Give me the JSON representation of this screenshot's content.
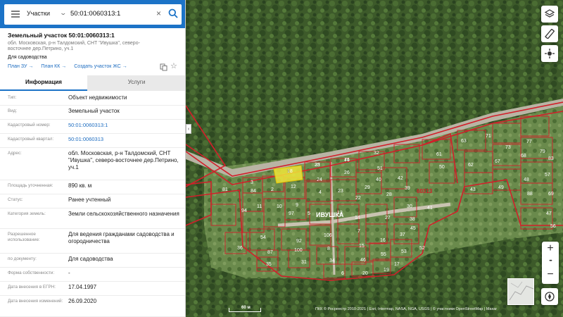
{
  "search": {
    "type_label": "Участки",
    "query": "50:01:0060313:1"
  },
  "object": {
    "title": "Земельный участок 50:01:0060313:1",
    "address_short": "обл. Московская, р-н Талдомский, СНТ \"Ивушка\", северо-восточнее дер.Петрино, уч.1",
    "purpose": "Для садоводства",
    "links": [
      "План ЗУ →",
      "План КК →",
      "Создать участок ЖС →"
    ]
  },
  "tabs": [
    "Информация",
    "Услуги"
  ],
  "info_rows": [
    {
      "label": "Тип:",
      "value": "Объект недвижимости",
      "link": false
    },
    {
      "label": "Вид:",
      "value": "Земельный участок",
      "link": false
    },
    {
      "label": "Кадастровый номер:",
      "value": "50:01:0060313:1",
      "link": true
    },
    {
      "label": "Кадастровый квартал:",
      "value": "50:01:0060313",
      "link": true
    },
    {
      "label": "Адрес:",
      "value": "обл. Московская, р-н Талдомский, СНТ \"Ивушка\", северо-восточнее дер.Петрино, уч.1",
      "link": false
    },
    {
      "label": "Площадь уточненная:",
      "value": "890 кв. м",
      "link": false
    },
    {
      "label": "Статус:",
      "value": "Ранее учтенный",
      "link": false
    },
    {
      "label": "Категория земель:",
      "value": "Земли сельскохозяйственного назначения",
      "link": false
    },
    {
      "label": "Разрешенное использование:",
      "value": "Для ведения гражданами садоводства и огородничества",
      "link": false
    },
    {
      "label": "по документу:",
      "value": "Для садоводства",
      "link": false
    },
    {
      "label": "Форма собственности:",
      "value": "-",
      "link": false
    },
    {
      "label": "Дата внесения в ЕГРН:",
      "value": "17.04.1997",
      "link": false
    },
    {
      "label": "Дата внесения изменений:",
      "value": "26.09.2020",
      "link": false
    }
  ],
  "map": {
    "settlement_label": "ИВУШКА",
    "quarter_label": "60313",
    "parcel_numbers": [
      "1",
      "25",
      "75",
      "32",
      "51",
      "61",
      "63",
      "71",
      "73",
      "77",
      "3",
      "12",
      "24",
      "26",
      "40",
      "42",
      "50",
      "62",
      "67",
      "68",
      "79",
      "81",
      "84",
      "2",
      "11",
      "10",
      "9",
      "4",
      "23",
      "22",
      "29",
      "28",
      "39",
      "43",
      "49",
      "48",
      "57",
      "69",
      "83",
      "88",
      "94",
      "97",
      "5",
      "13",
      "14",
      "27",
      "30",
      "38",
      "41",
      "47",
      "56",
      "54",
      "87",
      "92",
      "100",
      "106",
      "8",
      "7",
      "15",
      "16",
      "37",
      "36",
      "35",
      "31",
      "34",
      "46",
      "55",
      "53",
      "52",
      "45",
      "6",
      "20",
      "19",
      "17",
      "18",
      "33",
      "44"
    ],
    "scale_label": "60 м",
    "attribution": "ПКК © Росреестр 2010-2021 | Esri, Intermap, NASA, NGA, USGS | © участники OpenStreetMap | Maxar"
  },
  "controls": {
    "zoom_in": "+",
    "zoom_dots": "•••",
    "zoom_out": "−"
  },
  "colors": {
    "accent": "#1c73c7",
    "boundary": "#d21f2a",
    "selected_parcel": "#f0e63a"
  },
  "icons": [
    "menu-icon",
    "chevron-down-icon",
    "close-icon",
    "search-icon",
    "copy-icon",
    "star-icon",
    "layers-icon",
    "ruler-icon",
    "location-icon",
    "compass-icon"
  ]
}
